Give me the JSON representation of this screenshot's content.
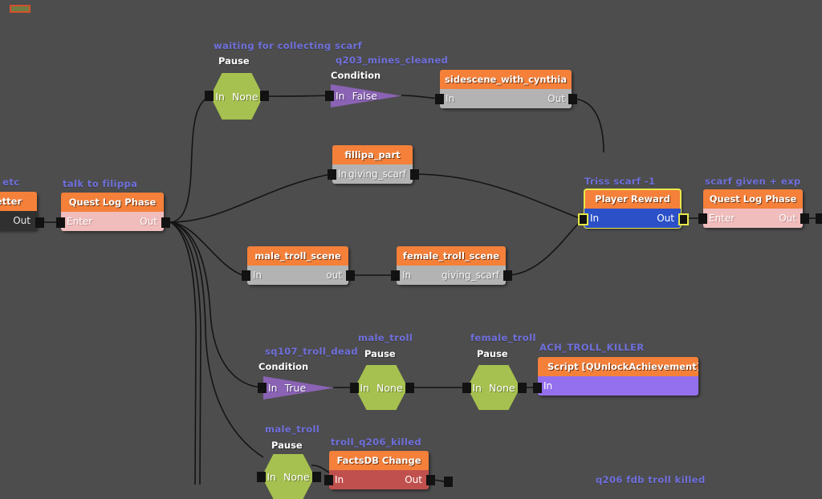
{
  "editor": {
    "name": "quest-node-graph-editor",
    "background_color": "#4d4d4d",
    "label_color": "#6f6fdc",
    "header_color": "#f4803a",
    "selection_color": "#e8e84a"
  },
  "nodes": [
    {
      "id": "partial-left-letter",
      "label": ", etc",
      "header": "etter",
      "in_port": "",
      "out_port": "Out",
      "body_style": "dark"
    },
    {
      "id": "pause-waiting-scarf",
      "label": "waiting for collecting scarf",
      "type": "Pause",
      "in_port": "In",
      "out_port": "None",
      "shape": "hexagon"
    },
    {
      "id": "condition-q203",
      "label": "q203_mines_cleaned",
      "type": "Condition",
      "in_port": "In",
      "out_port": "False",
      "shape": "triangle"
    },
    {
      "id": "sidescene-with-cynthia",
      "header": "sidescene_with_cynthia",
      "in_port": "In",
      "out_port": "Out",
      "body_style": "grey"
    },
    {
      "id": "fillipa-part",
      "header": "fillipa_part",
      "in_port": "In",
      "out_port": "giving_scarf",
      "body_style": "grey"
    },
    {
      "id": "quest-log-phase-talk",
      "label": "talk to filippa",
      "header": "Quest Log Phase",
      "in_port": "Enter",
      "out_port": "Out",
      "body_style": "pink"
    },
    {
      "id": "male-troll-scene",
      "header": "male_troll_scene",
      "in_port": "In",
      "out_port": "out",
      "body_style": "grey"
    },
    {
      "id": "female-troll-scene",
      "header": "female_troll_scene",
      "in_port": "In",
      "out_port": "giving_scarf",
      "body_style": "grey"
    },
    {
      "id": "player-reward",
      "label": "Triss scarf -1",
      "header": "Player Reward",
      "in_port": "In",
      "out_port": "Out",
      "body_style": "blue",
      "selected": true
    },
    {
      "id": "quest-log-phase-scarf",
      "label": "scarf given + exp",
      "header": "Quest Log Phase",
      "in_port": "Enter",
      "out_port": "Out",
      "body_style": "pink"
    },
    {
      "id": "condition-sq107",
      "label": "sq107_troll_dead",
      "type": "Condition",
      "in_port": "In",
      "out_port": "True",
      "shape": "triangle"
    },
    {
      "id": "pause-male-troll",
      "label": "male_troll",
      "type": "Pause",
      "in_port": "In",
      "out_port": "None",
      "shape": "hexagon"
    },
    {
      "id": "pause-female-troll",
      "label": "female_troll",
      "type": "Pause",
      "in_port": "In",
      "out_port": "None",
      "shape": "hexagon"
    },
    {
      "id": "script-ach-troll-killer",
      "label": "ACH_TROLL_KILLER",
      "header": "Script [QUnlockAchievement]",
      "in_port": "In",
      "body_style": "purple"
    },
    {
      "id": "pause-male-troll-2",
      "label": "male_troll",
      "type": "Pause",
      "in_port": "In",
      "out_port": "None",
      "shape": "hexagon"
    },
    {
      "id": "factsdb-change",
      "label": "troll_q206_killed",
      "header": "FactsDB Change",
      "in_port": "In",
      "out_port": "Out",
      "body_style": "red"
    },
    {
      "id": "label-q206-fdb",
      "label": "q206 fdb troll killed"
    }
  ]
}
